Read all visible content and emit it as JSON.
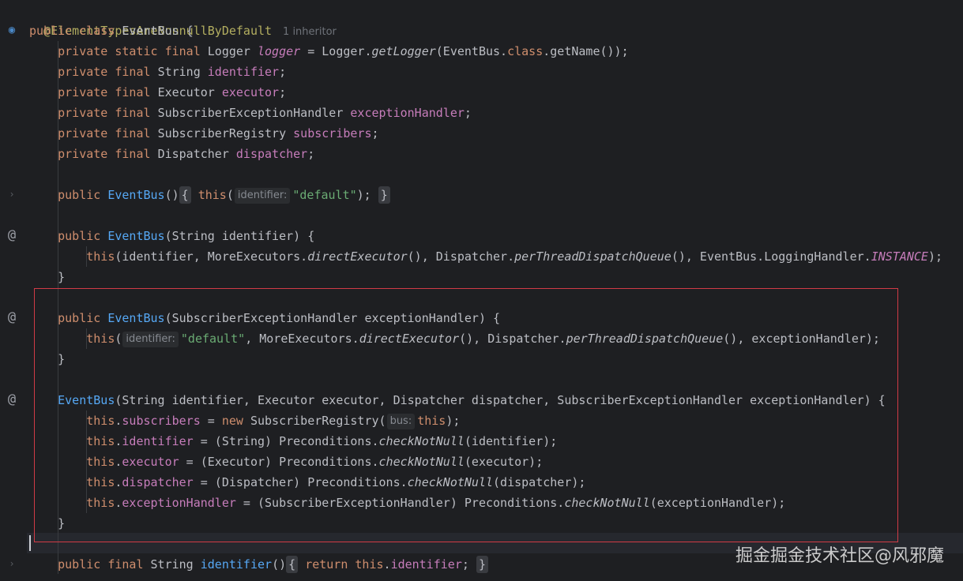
{
  "annotation": "@ElementTypesAreNonnullByDefault",
  "inheritor_hint": "1 inheritor",
  "class_decl": {
    "public": "public",
    "class": "class",
    "name": "EventBus",
    "brace": "{"
  },
  "fields": [
    {
      "mods": "private static final",
      "type": "Logger",
      "name": "logger",
      "rest_pre": " = Logger.",
      "call": "getLogger",
      "rest_post": "(EventBus.",
      "cls": "class",
      "tail": ".getName());"
    },
    {
      "mods": "private final",
      "type": "String",
      "name": "identifier",
      "semi": ";"
    },
    {
      "mods": "private final",
      "type": "Executor",
      "name": "executor",
      "semi": ";"
    },
    {
      "mods": "private final",
      "type": "SubscriberExceptionHandler",
      "name": "exceptionHandler",
      "semi": ";"
    },
    {
      "mods": "private final",
      "type": "SubscriberRegistry",
      "name": "subscribers",
      "semi": ";"
    },
    {
      "mods": "private final",
      "type": "Dispatcher",
      "name": "dispatcher",
      "semi": ";"
    }
  ],
  "ctor1": {
    "public": "public",
    "name": "EventBus",
    "parens": "()",
    "open": "{",
    "this": "this",
    "hint": "identifier:",
    "arg": "\"default\"",
    "close_call": ");",
    "close": "}"
  },
  "ctor2": {
    "public": "public",
    "name": "EventBus",
    "sig": "(String identifier) {",
    "this": "this",
    "body": "(identifier, MoreExecutors.",
    "m1": "directExecutor",
    "b2": "(), Dispatcher.",
    "m2": "perThreadDispatchQueue",
    "b3": "(), EventBus.LoggingHandler.",
    "c1": "INSTANCE",
    "b4": ");",
    "close": "}"
  },
  "ctor3": {
    "public": "public",
    "name": "EventBus",
    "sig": "(SubscriberExceptionHandler exceptionHandler) {",
    "this": "this",
    "open_paren": "(",
    "hint": "identifier:",
    "arg": "\"default\"",
    "b1": ", MoreExecutors.",
    "m1": "directExecutor",
    "b2": "(), Dispatcher.",
    "m2": "perThreadDispatchQueue",
    "b3": "(), exceptionHandler);",
    "close": "}"
  },
  "ctor4": {
    "name": "EventBus",
    "sig": "(String identifier, Executor executor, Dispatcher dispatcher, SubscriberExceptionHandler exceptionHandler) {",
    "lines": [
      {
        "this": "this",
        "dot": ".",
        "field": "subscribers",
        "eq": " = ",
        "new": "new",
        "rest": " SubscriberRegistry(",
        "hint": "bus:",
        "arg": "this",
        "tail": ");"
      },
      {
        "this": "this",
        "dot": ".",
        "field": "identifier",
        "eq": " = (String) Preconditions.",
        "m": "checkNotNull",
        "tail": "(identifier);"
      },
      {
        "this": "this",
        "dot": ".",
        "field": "executor",
        "eq": " = (Executor) Preconditions.",
        "m": "checkNotNull",
        "tail": "(executor);"
      },
      {
        "this": "this",
        "dot": ".",
        "field": "dispatcher",
        "eq": " = (Dispatcher) Preconditions.",
        "m": "checkNotNull",
        "tail": "(dispatcher);"
      },
      {
        "this": "this",
        "dot": ".",
        "field": "exceptionHandler",
        "eq": " = (SubscriberExceptionHandler) Preconditions.",
        "m": "checkNotNull",
        "tail": "(exceptionHandler);"
      }
    ],
    "close": "}"
  },
  "getter": {
    "mods": "public final",
    "type": "String",
    "name": "identifier",
    "parens": "()",
    "open": "{",
    "ret": "return",
    "this": "this",
    "field_dot": ".",
    "field": "identifier",
    "semi": ";",
    "close": "}"
  },
  "watermark": "掘金掘金技术社区@风邪魔",
  "colors": {
    "highlight_box": "#d13b46",
    "keyword": "#cf8e6d",
    "field": "#c77dbb",
    "method": "#56a8f5",
    "string": "#6aab73"
  }
}
